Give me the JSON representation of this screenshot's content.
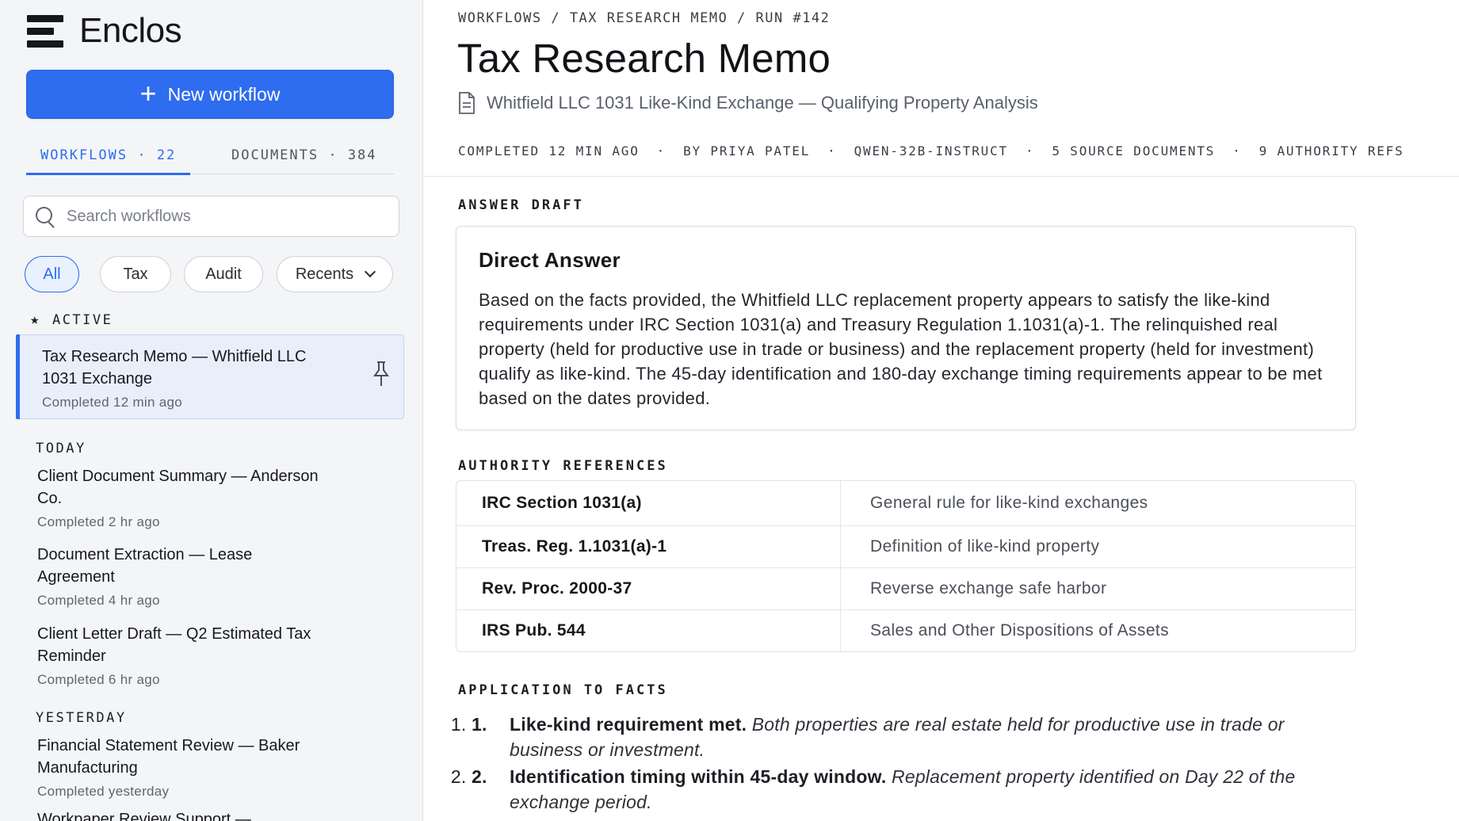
{
  "app": {
    "name": "Enclos"
  },
  "sidebar": {
    "new_workflow_label": "New workflow",
    "tabs": [
      {
        "label": "WORKFLOWS · 22"
      },
      {
        "label": "DOCUMENTS · 384"
      }
    ],
    "search_placeholder": "Search workflows",
    "filters": [
      "All",
      "Tax",
      "Audit",
      "Recents"
    ],
    "active_label": "ACTIVE",
    "active_item": {
      "title": "Tax Research Memo — Whitfield LLC 1031 Exchange",
      "status": "Completed 12 min ago"
    },
    "today_label": "TODAY",
    "today": [
      {
        "title": "Client Document Summary — Anderson Co.",
        "status": "Completed 2 hr ago"
      },
      {
        "title": "Document Extraction — Lease Agreement",
        "status": "Completed 4 hr ago"
      },
      {
        "title": "Client Letter Draft — Q2 Estimated Tax Reminder",
        "status": "Completed 6 hr ago"
      }
    ],
    "yesterday_label": "YESTERDAY",
    "yesterday": [
      {
        "title": "Financial Statement Review — Baker Manufacturing",
        "status": "Completed yesterday"
      },
      {
        "title": "Workpaper Review Support —"
      }
    ]
  },
  "main": {
    "breadcrumb": "WORKFLOWS / TAX RESEARCH MEMO / RUN #142",
    "title": "Tax Research Memo",
    "subtitle": "Whitfield LLC 1031 Like-Kind Exchange — Qualifying Property Analysis",
    "meta": {
      "completed": "COMPLETED 12 MIN AGO",
      "author": "BY PRIYA PATEL",
      "model": "QWEN-32B-INSTRUCT",
      "sources": "5 SOURCE DOCUMENTS",
      "refs": "9 AUTHORITY REFS"
    },
    "answer_label": "ANSWER DRAFT",
    "answer_title": "Direct Answer",
    "answer_body": "Based on the facts provided, the Whitfield LLC replacement property appears to satisfy the like-kind requirements under IRC Section 1031(a) and Treasury Regulation 1.1031(a)-1. The relinquished real property (held for productive use in trade or business) and the replacement property (held for investment) qualify as like-kind. The 45-day identification and 180-day exchange timing requirements appear to be met based on the dates provided.",
    "authority_label": "AUTHORITY REFERENCES",
    "authorities": [
      {
        "cite": "IRC Section 1031(a)",
        "desc": "General rule for like-kind exchanges"
      },
      {
        "cite": "Treas. Reg. 1.1031(a)-1",
        "desc": "Definition of like-kind property"
      },
      {
        "cite": "Rev. Proc. 2000-37",
        "desc": "Reverse exchange safe harbor"
      },
      {
        "cite": "IRS Pub. 544",
        "desc": "Sales and Other Dispositions of Assets"
      }
    ],
    "facts_label": "APPLICATION TO FACTS",
    "facts": [
      {
        "num": "1.",
        "lead": "Like-kind requirement met.",
        "detail": "Both properties are real estate held for productive use in trade or business or investment."
      },
      {
        "num": "2.",
        "lead": "Identification timing within 45-day window.",
        "detail": "Replacement property identified on Day 22 of the exchange period."
      }
    ]
  }
}
